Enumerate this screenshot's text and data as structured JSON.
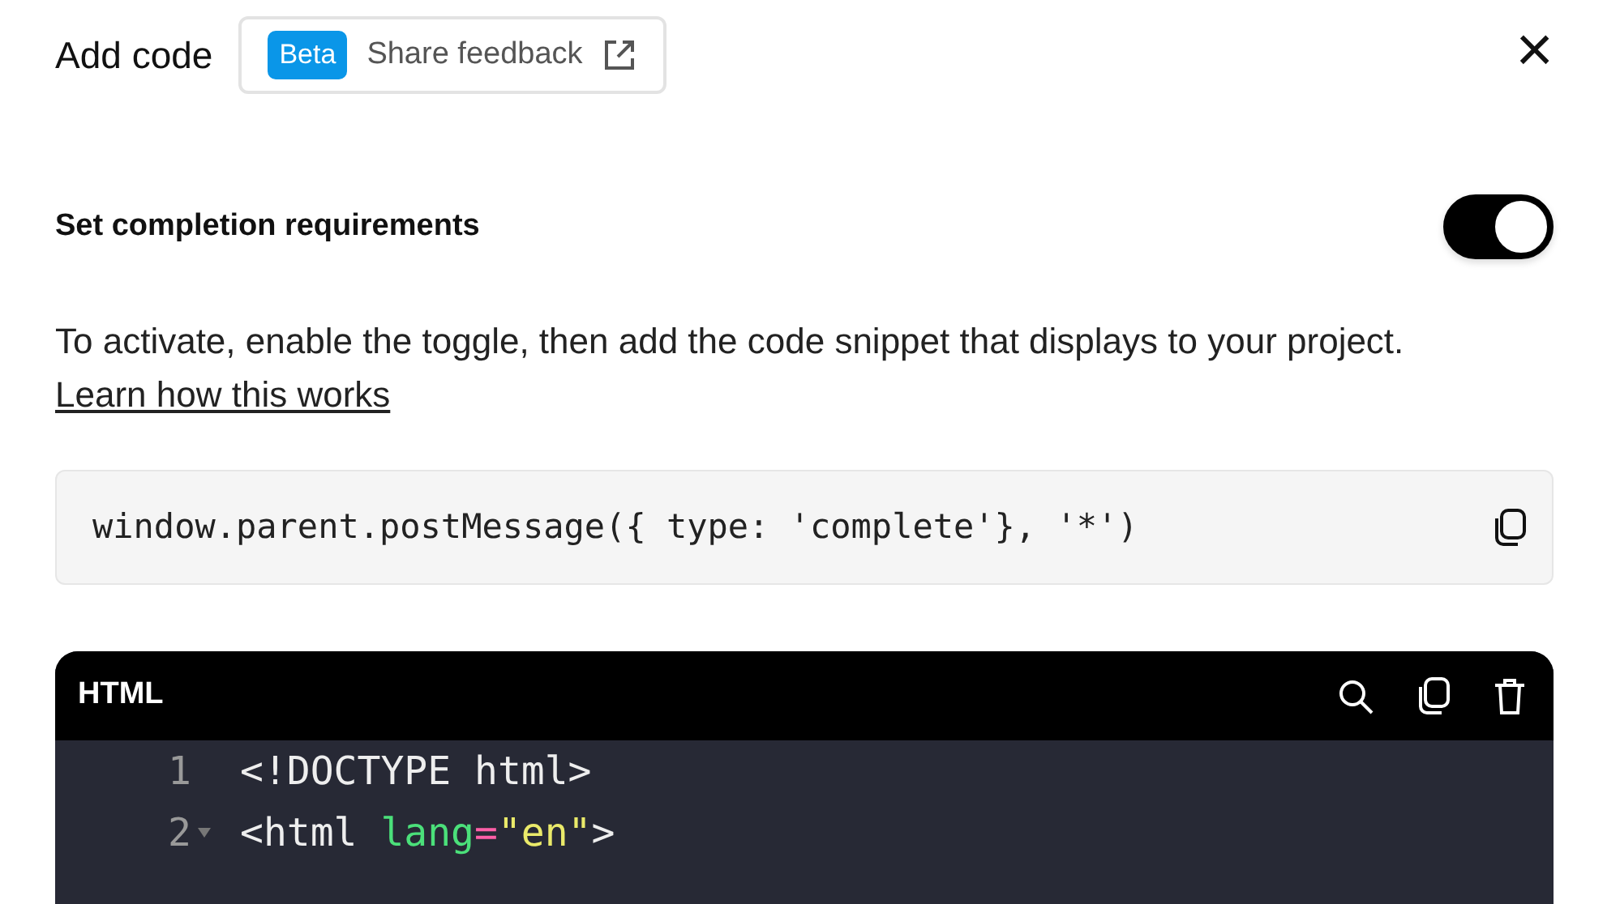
{
  "header": {
    "title": "Add code",
    "badge": "Beta",
    "feedback_link": "Share feedback",
    "close": "×"
  },
  "requirement": {
    "label": "Set completion requirements",
    "on": true
  },
  "description": {
    "text": "To activate, enable the toggle, then add the code snippet that displays to your project.",
    "link": "Learn how this works"
  },
  "snippet": {
    "code": "window.parent.postMessage({ type: 'complete'}, '*')"
  },
  "editor": {
    "language": "HTML",
    "lines": [
      {
        "number": "1",
        "fold": false,
        "tokens": [
          {
            "kind": "plain",
            "text": "<!DOCTYPE html>"
          }
        ]
      },
      {
        "number": "2",
        "fold": true,
        "tokens": [
          {
            "kind": "plain",
            "text": "<html "
          },
          {
            "kind": "attr",
            "text": "lang"
          },
          {
            "kind": "op",
            "text": "="
          },
          {
            "kind": "string",
            "text": "\"en\""
          },
          {
            "kind": "plain",
            "text": ">"
          }
        ]
      }
    ]
  }
}
